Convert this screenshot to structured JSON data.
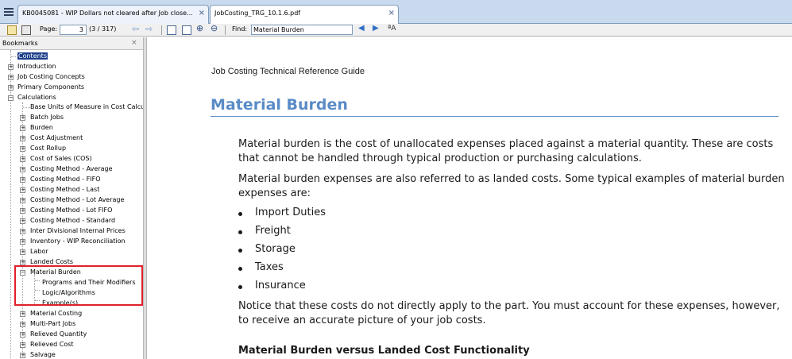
{
  "tabs": [
    {
      "label": "KB0045081 - WIP Dollars not cleared after Job close...",
      "close": "×"
    },
    {
      "label": "JobCosting_TRG_10.1.6.pdf",
      "close": "×"
    }
  ],
  "toolbar": {
    "page_label": "Page:",
    "page_value": "3",
    "page_count": "(3 / 317)",
    "find_label": "Find:",
    "find_value": "Material Burden"
  },
  "bookmarks": {
    "title": "Bookmarks",
    "close": "×",
    "items": [
      {
        "label": "Contents"
      },
      {
        "label": "Introduction"
      },
      {
        "label": "Job Costing Concepts"
      },
      {
        "label": "Primary Components"
      },
      {
        "label": "Calculations"
      },
      {
        "label": "Base Units of Measure in Cost Calcu"
      },
      {
        "label": "Batch Jobs"
      },
      {
        "label": "Burden"
      },
      {
        "label": "Cost Adjustment"
      },
      {
        "label": "Cost Rollup"
      },
      {
        "label": "Cost of Sales (COS)"
      },
      {
        "label": "Costing Method - Average"
      },
      {
        "label": "Costing Method - FIFO"
      },
      {
        "label": "Costing Method - Last"
      },
      {
        "label": "Costing Method - Lot Average"
      },
      {
        "label": "Costing Method - Lot FIFO"
      },
      {
        "label": "Costing Method - Standard"
      },
      {
        "label": "Inter Divisional Internal Prices"
      },
      {
        "label": "Inventory - WIP Reconciliation"
      },
      {
        "label": "Labor"
      },
      {
        "label": "Landed Costs"
      },
      {
        "label": "Material Burden"
      },
      {
        "label": "Programs and Their Modifiers"
      },
      {
        "label": "Logic/Algorithms"
      },
      {
        "label": "Example(s)"
      },
      {
        "label": "Material Costing"
      },
      {
        "label": "Multi-Part Jobs"
      },
      {
        "label": "Relieved Quantity"
      },
      {
        "label": "Relieved Cost"
      },
      {
        "label": "Salvage"
      }
    ]
  },
  "document": {
    "header": "Job Costing Technical Reference Guide",
    "title": "Material Burden",
    "para1": "Material burden is the cost of unallocated expenses placed against a material quantity. These are costs that cannot be handled through typical production or purchasing calculations.",
    "para2": "Material burden expenses are also referred to as landed costs. Some typical examples of material burden expenses are:",
    "bullets": [
      "Import Duties",
      "Freight",
      "Storage",
      "Taxes",
      "Insurance"
    ],
    "para3": "Notice that these costs do not directly apply to the part. You must account for these expenses, however, to receive an accurate picture of your job costs.",
    "subheading": "Material Burden versus Landed Cost Functionality"
  },
  "colors": {
    "title_blue": "#5a8bc6",
    "highlight_red": "#e0202a",
    "selection_blue": "#1c3e8a"
  }
}
